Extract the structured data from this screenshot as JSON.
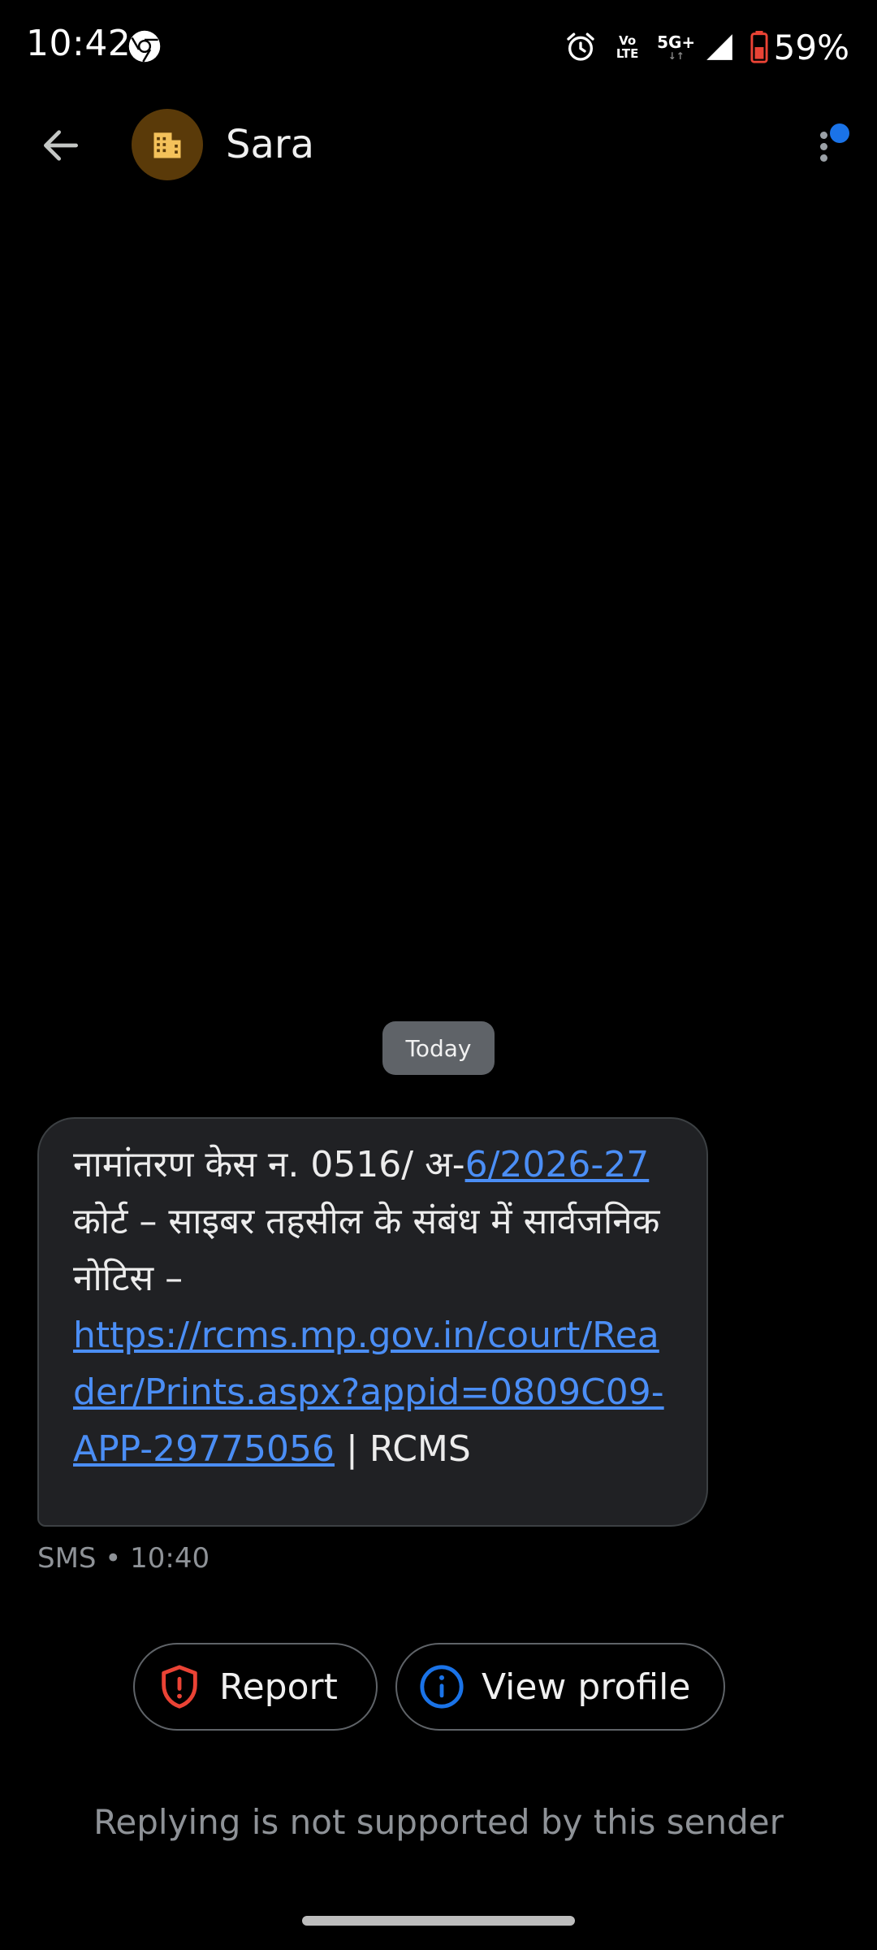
{
  "status_bar": {
    "time": "10:42",
    "volte_line1": "Vo",
    "volte_line2": "LTE",
    "network": "5G+",
    "battery": "59%",
    "icons": [
      "chrome-icon",
      "alarm-icon",
      "volte-icon",
      "network-5g-icon",
      "signal-icon",
      "battery-icon"
    ]
  },
  "app_bar": {
    "contact_name": "Sara",
    "avatar_icon": "building-icon",
    "menu_badge_color": "#1a73e8"
  },
  "conversation": {
    "date_chip": "Today",
    "message": {
      "text_1": "नामांतरण केस न. 0516/ अ-",
      "link_1": "6/2026-27",
      "text_2": " कोर्ट – साइबर तहसील के संबंध में सार्वजनिक नोटिस – ",
      "link_2": "https://rcms.mp.gov.in/court/Reader/Prints.aspx?appid=0809C09-APP-29775056",
      "text_3": " | RCMS",
      "meta": "SMS • 10:40"
    }
  },
  "actions": {
    "report_label": "Report",
    "view_profile_label": "View profile",
    "report_icon_color": "#ea4335",
    "profile_icon_color": "#1a73e8"
  },
  "footer": {
    "reply_note": "Replying is not supported by this sender"
  }
}
